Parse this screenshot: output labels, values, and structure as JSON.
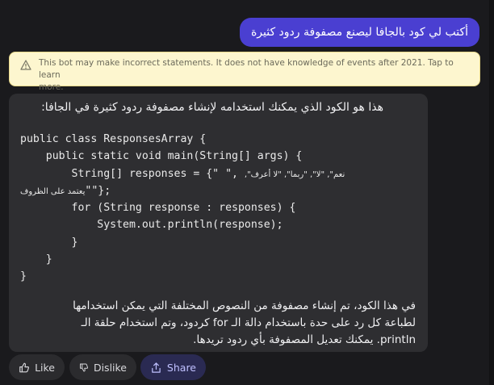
{
  "user_message": "أكتب لي كود بالجافا ليصنع مصفوفة ردود كثيرة",
  "disclaimer": {
    "line1": "This bot may make incorrect statements. It does not have knowledge of events after 2021. Tap to learn",
    "line2": "more."
  },
  "bot": {
    "intro": "هذا هو الكود الذي يمكنك استخدامه لإنشاء مصفوفة ردود كثيرة في الجافا:",
    "code": {
      "l1": "public class ResponsesArray {",
      "l2": "    public static void main(String[] args) {",
      "l3a": "        String[] responses = {\" \",",
      "l3b": "نعم\", \"لا\", \"ربما\", \"لا أعرف\",",
      "l4a": "يعتمد على الظروف",
      "l4b": "\"\"};",
      "l5": "        for (String response : responses) {",
      "l6": "            System.out.println(response);",
      "l7": "        }",
      "l8": "    }",
      "l9": "}"
    },
    "outro": {
      "line1": "في هذا الكود، تم إنشاء مصفوفة من النصوص المختلفة التي يمكن استخدامها",
      "line2": "لطباعة كل رد على حدة باستخدام دالة الـ for كردود، وتم استخدام حلقة الـ",
      "line3": "println. يمكنك تعديل المصفوفة بأي ردود تريدها."
    }
  },
  "actions": {
    "like": "Like",
    "dislike": "Dislike",
    "share": "Share"
  },
  "colors": {
    "user_bubble": "#4a3fd1",
    "bot_bubble": "#2e2e31",
    "disclaimer_bg": "#fdf6cf",
    "share_accent": "#bfc0ff"
  },
  "icons": {
    "warning": "warning-icon",
    "like": "thumbs-up-icon",
    "dislike": "thumbs-down-icon",
    "share": "share-icon"
  }
}
